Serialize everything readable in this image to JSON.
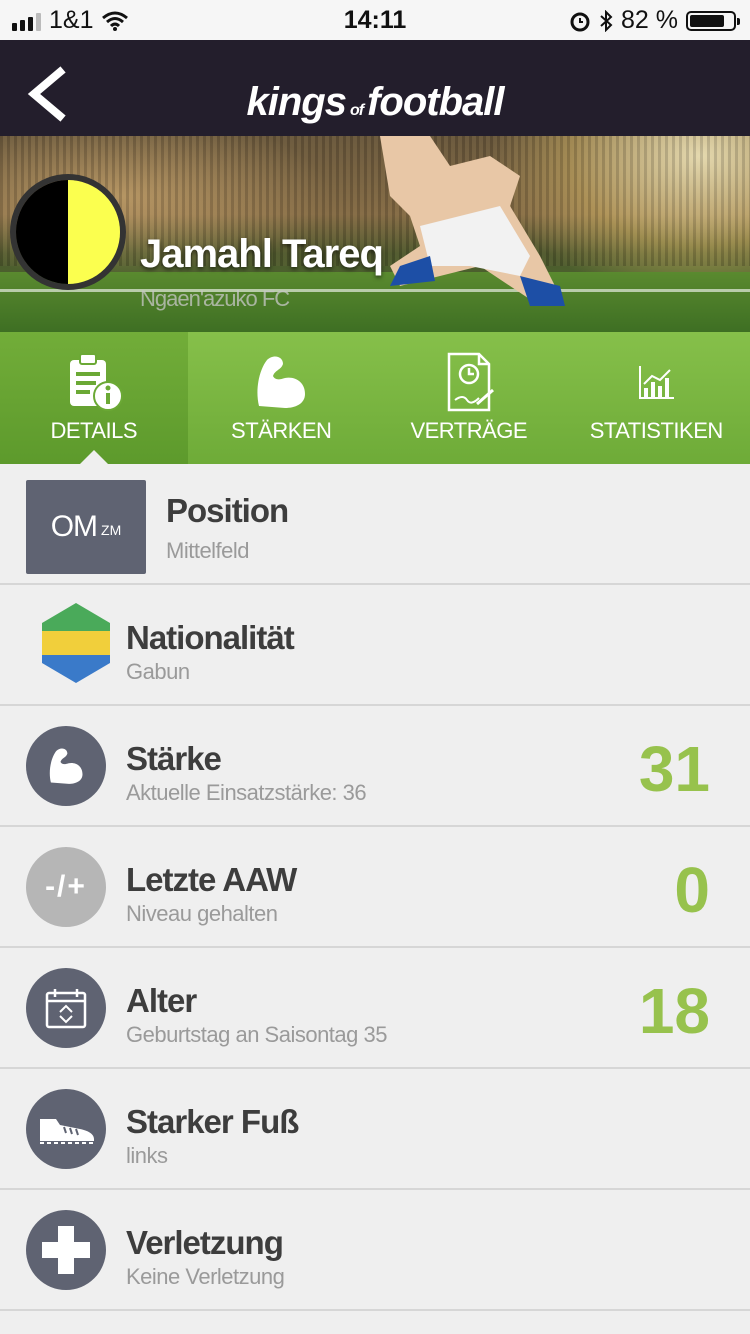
{
  "status_bar": {
    "carrier": "1&1",
    "time": "14:11",
    "battery_percent": "82 %"
  },
  "header": {
    "logo_main": "kings",
    "logo_of": "of",
    "logo_end": "football"
  },
  "player": {
    "name": "Jamahl Tareq",
    "club": "Ngaen'azuko FC",
    "club_colors": [
      "#000000",
      "#fbff4f"
    ]
  },
  "tabs": [
    {
      "label": "DETAILS",
      "icon": "details-icon",
      "active": true
    },
    {
      "label": "STÄRKEN",
      "icon": "muscle-icon",
      "active": false
    },
    {
      "label": "VERTRÄGE",
      "icon": "contract-icon",
      "active": false
    },
    {
      "label": "STATISTIKEN",
      "icon": "chart-icon",
      "active": false
    }
  ],
  "details": {
    "position": {
      "title": "Position",
      "sub": "Mittelfeld",
      "main": "OM",
      "minor": "ZM"
    },
    "nationality": {
      "title": "Nationalität",
      "sub": "Gabun"
    },
    "strength": {
      "title": "Stärke",
      "sub": "Aktuelle Einsatzstärke: 36",
      "value": "31"
    },
    "last_aaw": {
      "title": "Letzte AAW",
      "sub": "Niveau gehalten",
      "value": "0",
      "icon_text": "-/+"
    },
    "age": {
      "title": "Alter",
      "sub": "Geburtstag an Saisontag 35",
      "value": "18"
    },
    "foot": {
      "title": "Starker Fuß",
      "sub": "links"
    },
    "injury": {
      "title": "Verletzung",
      "sub": "Keine Verletzung"
    }
  },
  "colors": {
    "accent_green": "#97c24d",
    "nav_dark": "#231e2c",
    "icon_circle": "#5f6372"
  }
}
